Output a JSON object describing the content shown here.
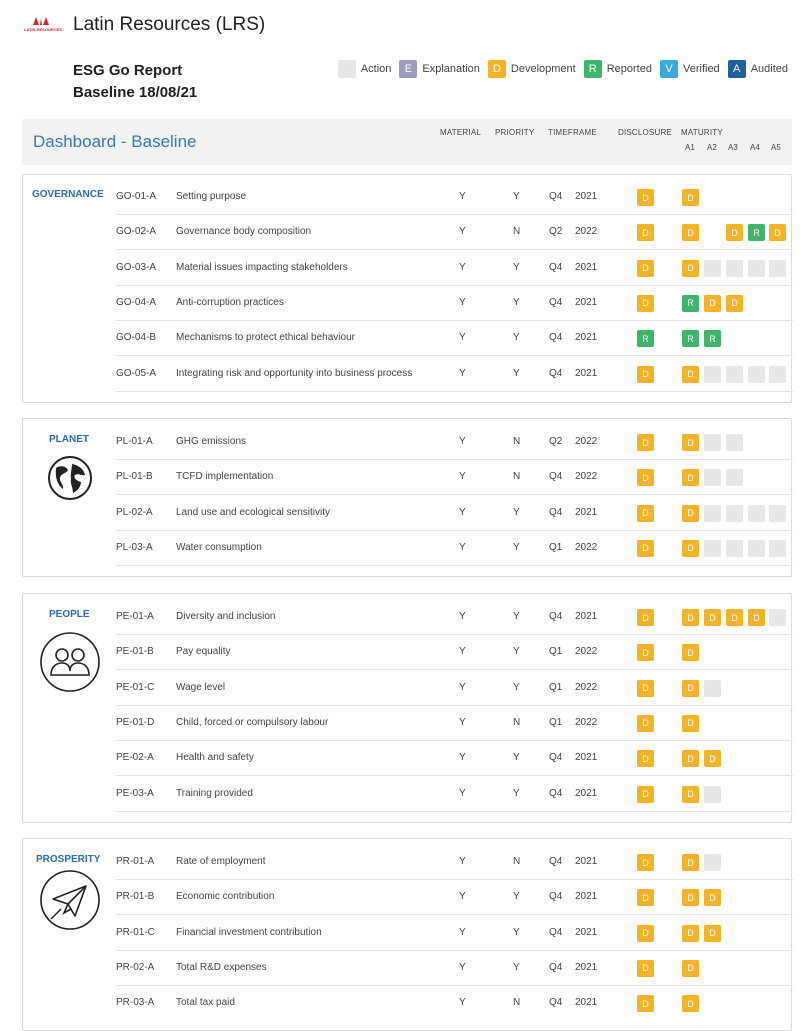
{
  "company": {
    "logo_text": "LATIN RESOURCES",
    "name": "Latin Resources (LRS)"
  },
  "report": {
    "title": "ESG Go Report",
    "baseline": "Baseline 18/08/21"
  },
  "legend": [
    {
      "badge": "",
      "label": "Action",
      "color": "#e7e7e7"
    },
    {
      "badge": "E",
      "label": "Explanation",
      "color": "#9b9bbd"
    },
    {
      "badge": "D",
      "label": "Development",
      "color": "#f3b227"
    },
    {
      "badge": "R",
      "label": "Reported",
      "color": "#3fb56b"
    },
    {
      "badge": "V",
      "label": "Verified",
      "color": "#3ba9dc"
    },
    {
      "badge": "A",
      "label": "Audited",
      "color": "#1f5f9d"
    }
  ],
  "dashboard": {
    "title": "Dashboard - Baseline",
    "columns": {
      "material": "MATERIAL",
      "priority": "PRIORITY",
      "timeframe": "TIMEFRAME",
      "disclosure": "DISCLOSURE",
      "maturity": "MATURITY"
    },
    "levels": [
      "A1",
      "A2",
      "A3",
      "A4",
      "A5"
    ]
  },
  "sections": [
    {
      "label": "GOVERNANCE",
      "icon": "none",
      "rows": [
        {
          "code": "GO-01-A",
          "name": "Setting purpose",
          "material": "Y",
          "priority": "Y",
          "quarter": "Q4",
          "year": "2021",
          "disclosure": "D",
          "maturity": [
            "D",
            null,
            null,
            null,
            null
          ]
        },
        {
          "code": "GO-02-A",
          "name": "Governance body composition",
          "material": "Y",
          "priority": "N",
          "quarter": "Q2",
          "year": "2022",
          "disclosure": "D",
          "maturity": [
            "D",
            null,
            "D",
            "R",
            "D"
          ]
        },
        {
          "code": "GO-03-A",
          "name": "Material issues impacting stakeholders",
          "material": "Y",
          "priority": "Y",
          "quarter": "Q4",
          "year": "2021",
          "disclosure": "D",
          "maturity": [
            "D",
            "",
            "",
            "",
            ""
          ]
        },
        {
          "code": "GO-04-A",
          "name": "Anti-corruption practices",
          "material": "Y",
          "priority": "Y",
          "quarter": "Q4",
          "year": "2021",
          "disclosure": "D",
          "maturity": [
            "R",
            "D",
            "D",
            null,
            null
          ]
        },
        {
          "code": "GO-04-B",
          "name": "Mechanisms to protect ethical behaviour",
          "material": "Y",
          "priority": "Y",
          "quarter": "Q4",
          "year": "2021",
          "disclosure": "R",
          "maturity": [
            "R",
            "R",
            null,
            null,
            null
          ]
        },
        {
          "code": "GO-05-A",
          "name": "Integrating risk and opportunity into business process",
          "material": "Y",
          "priority": "Y",
          "quarter": "Q4",
          "year": "2021",
          "disclosure": "D",
          "maturity": [
            "D",
            "",
            "",
            "",
            ""
          ]
        }
      ]
    },
    {
      "label": "PLANET",
      "icon": "globe-icon",
      "rows": [
        {
          "code": "PL-01-A",
          "name": "GHG emissions",
          "material": "Y",
          "priority": "N",
          "quarter": "Q2",
          "year": "2022",
          "disclosure": "D",
          "maturity": [
            "D",
            "",
            "",
            null,
            null
          ]
        },
        {
          "code": "PL-01-B",
          "name": "TCFD implementation",
          "material": "Y",
          "priority": "N",
          "quarter": "Q4",
          "year": "2022",
          "disclosure": "D",
          "maturity": [
            "D",
            "",
            "",
            null,
            null
          ]
        },
        {
          "code": "PL-02-A",
          "name": "Land use and ecological sensitivity",
          "material": "Y",
          "priority": "Y",
          "quarter": "Q4",
          "year": "2021",
          "disclosure": "D",
          "maturity": [
            "D",
            "",
            "",
            "",
            ""
          ]
        },
        {
          "code": "PL-03-A",
          "name": "Water consumption",
          "material": "Y",
          "priority": "Y",
          "quarter": "Q1",
          "year": "2022",
          "disclosure": "D",
          "maturity": [
            "D",
            "",
            "",
            "",
            ""
          ]
        }
      ]
    },
    {
      "label": "PEOPLE",
      "icon": "people-icon",
      "rows": [
        {
          "code": "PE-01-A",
          "name": "Diversity and inclusion",
          "material": "Y",
          "priority": "Y",
          "quarter": "Q4",
          "year": "2021",
          "disclosure": "D",
          "maturity": [
            "D",
            "D",
            "D",
            "D",
            ""
          ]
        },
        {
          "code": "PE-01-B",
          "name": "Pay equality",
          "material": "Y",
          "priority": "Y",
          "quarter": "Q1",
          "year": "2022",
          "disclosure": "D",
          "maturity": [
            "D",
            null,
            null,
            null,
            null
          ]
        },
        {
          "code": "PE-01-C",
          "name": "Wage level",
          "material": "Y",
          "priority": "Y",
          "quarter": "Q1",
          "year": "2022",
          "disclosure": "D",
          "maturity": [
            "D",
            "",
            null,
            null,
            null
          ]
        },
        {
          "code": "PE-01-D",
          "name": "Child, forced or compulsory labour",
          "material": "Y",
          "priority": "N",
          "quarter": "Q1",
          "year": "2022",
          "disclosure": "D",
          "maturity": [
            "D",
            null,
            null,
            null,
            null
          ]
        },
        {
          "code": "PE-02-A",
          "name": "Health and safety",
          "material": "Y",
          "priority": "Y",
          "quarter": "Q4",
          "year": "2021",
          "disclosure": "D",
          "maturity": [
            "D",
            "D",
            null,
            null,
            null
          ]
        },
        {
          "code": "PE-03-A",
          "name": "Training provided",
          "material": "Y",
          "priority": "Y",
          "quarter": "Q4",
          "year": "2021",
          "disclosure": "D",
          "maturity": [
            "D",
            "",
            null,
            null,
            null
          ]
        }
      ]
    },
    {
      "label": "PROSPERITY",
      "icon": "paper-plane-icon",
      "rows": [
        {
          "code": "PR-01-A",
          "name": "Rate of employment",
          "material": "Y",
          "priority": "N",
          "quarter": "Q4",
          "year": "2021",
          "disclosure": "D",
          "maturity": [
            "D",
            "",
            null,
            null,
            null
          ]
        },
        {
          "code": "PR-01-B",
          "name": "Economic contribution",
          "material": "Y",
          "priority": "Y",
          "quarter": "Q4",
          "year": "2021",
          "disclosure": "D",
          "maturity": [
            "D",
            "D",
            null,
            null,
            null
          ]
        },
        {
          "code": "PR-01-C",
          "name": "Financial investment contribution",
          "material": "Y",
          "priority": "Y",
          "quarter": "Q4",
          "year": "2021",
          "disclosure": "D",
          "maturity": [
            "D",
            "D",
            null,
            null,
            null
          ]
        },
        {
          "code": "PR-02-A",
          "name": "Total R&D expenses",
          "material": "Y",
          "priority": "Y",
          "quarter": "Q4",
          "year": "2021",
          "disclosure": "D",
          "maturity": [
            "D",
            null,
            null,
            null,
            null
          ]
        },
        {
          "code": "PR-03-A",
          "name": "Total tax paid",
          "material": "Y",
          "priority": "N",
          "quarter": "Q4",
          "year": "2021",
          "disclosure": "D",
          "maturity": [
            "D",
            null,
            null,
            null,
            null
          ]
        }
      ]
    }
  ]
}
